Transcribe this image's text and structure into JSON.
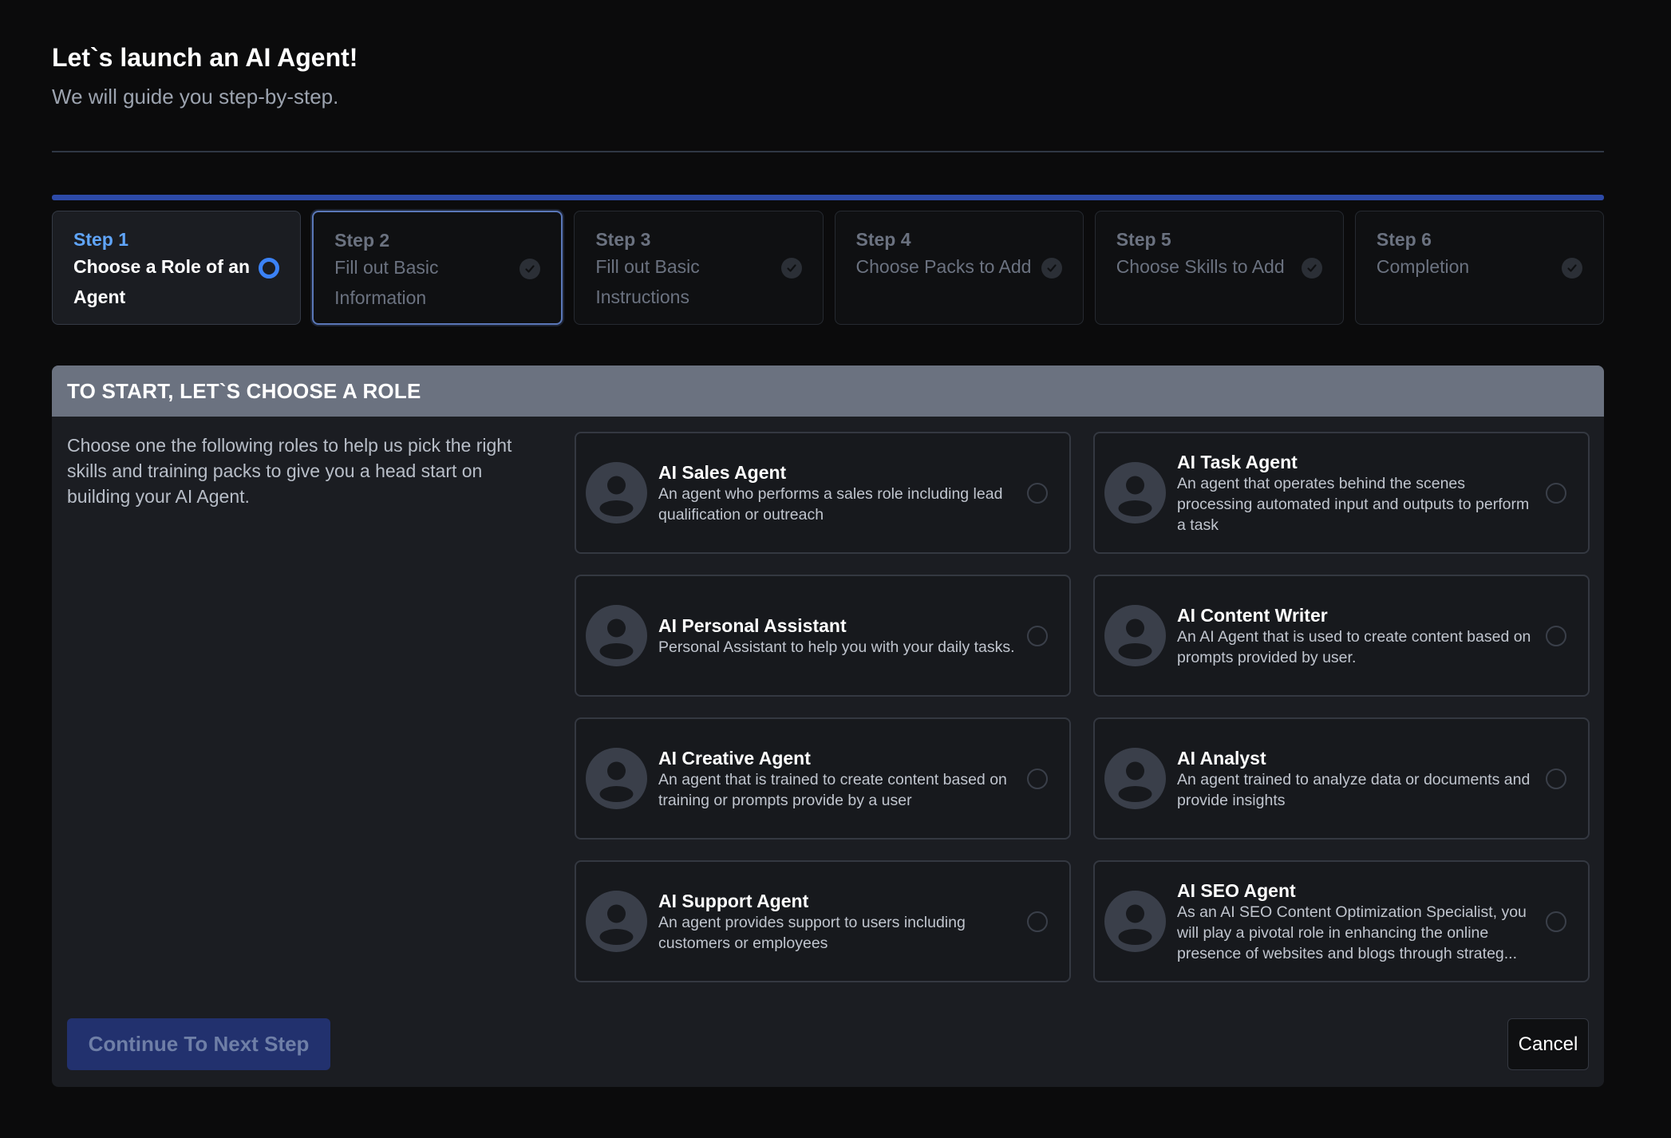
{
  "header": {
    "title": "Let`s launch an AI Agent!",
    "subtitle": "We will guide you step-by-step."
  },
  "steps": [
    {
      "number": "Step 1",
      "label": "Choose a Role of an Agent",
      "state": "active",
      "icon": "radio-ring-icon"
    },
    {
      "number": "Step 2",
      "label": "Fill out Basic Information",
      "state": "pending",
      "icon": "check-circle-icon"
    },
    {
      "number": "Step 3",
      "label": "Fill out Basic Instructions",
      "state": "pending",
      "icon": "check-circle-icon"
    },
    {
      "number": "Step 4",
      "label": "Choose Packs to Add",
      "state": "pending",
      "icon": "check-circle-icon"
    },
    {
      "number": "Step 5",
      "label": "Choose Skills to Add",
      "state": "pending",
      "icon": "check-circle-icon"
    },
    {
      "number": "Step 6",
      "label": "Completion",
      "state": "pending",
      "icon": "check-circle-icon"
    }
  ],
  "panel": {
    "heading": "TO START, LET`S CHOOSE A ROLE",
    "description": "Choose one the following roles to help us pick the right skills and training packs to give you a head start on building your AI Agent."
  },
  "roles": [
    {
      "title": "AI Sales Agent",
      "desc": "An agent who performs a sales role including lead qualification or outreach",
      "selected": false
    },
    {
      "title": "AI Task Agent",
      "desc": "An agent that operates behind the scenes processing automated input and outputs to perform a task",
      "selected": false
    },
    {
      "title": "AI Personal Assistant",
      "desc": "Personal Assistant to help you with your daily tasks.",
      "selected": false
    },
    {
      "title": "AI Content Writer",
      "desc": "An AI Agent that is used to create content based on prompts provided by user.",
      "selected": false
    },
    {
      "title": "AI Creative Agent",
      "desc": "An agent that is trained to create content based on training or prompts provide by a user",
      "selected": false
    },
    {
      "title": "AI Analyst",
      "desc": "An agent trained to analyze data or documents and provide insights",
      "selected": false
    },
    {
      "title": "AI Support Agent",
      "desc": "An agent provides support to users including customers or employees",
      "selected": false
    },
    {
      "title": "AI SEO Agent",
      "desc": "As an AI SEO Content Optimization Specialist, you will play a pivotal role in enhancing the online presence of websites and blogs through strateg...",
      "selected": false
    }
  ],
  "actions": {
    "continue_label": "Continue To Next Step",
    "cancel_label": "Cancel"
  },
  "colors": {
    "background": "#0b0b0c",
    "accent": "#3b82f6",
    "panel_header": "#6b7280",
    "primary_button": "#22316e"
  }
}
